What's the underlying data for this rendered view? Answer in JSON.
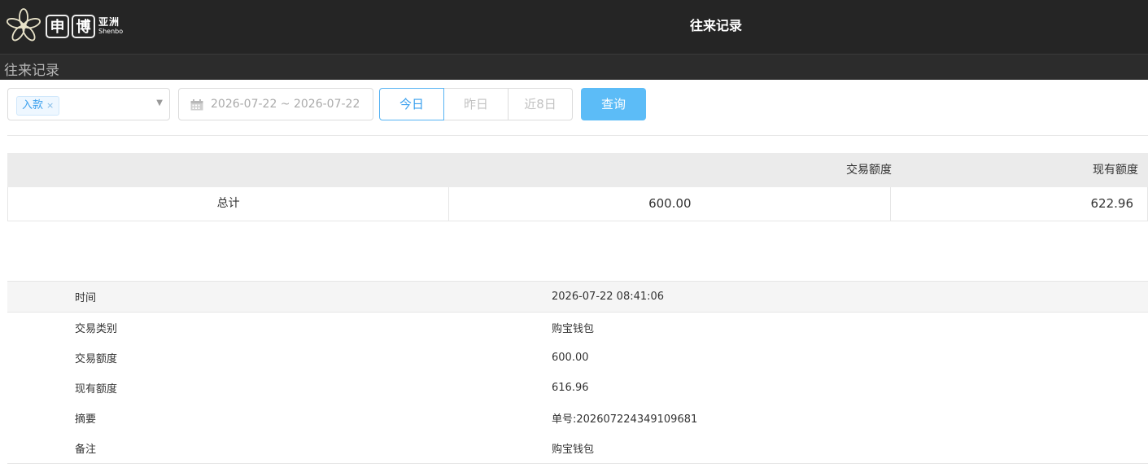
{
  "header": {
    "logo_char1": "申",
    "logo_char2": "博",
    "logo_cn": "亚洲",
    "logo_en": "Shenbo",
    "title": "往来记录"
  },
  "subheader": {
    "title": "往来记录"
  },
  "filters": {
    "type_tag": "入款",
    "type_tag_close": "×",
    "date_range": "2026-07-22 ~ 2026-07-22",
    "quick_today": "今日",
    "quick_yesterday": "昨日",
    "quick_8days": "近8日",
    "query_button": "查询"
  },
  "summary": {
    "headers": [
      "",
      "交易额度",
      "现有额度"
    ],
    "row": {
      "label": "总计",
      "amount": "600.00",
      "balance": "622.96"
    }
  },
  "detail": [
    {
      "label": "时间",
      "value": "2026-07-22 08:41:06"
    },
    {
      "label": "交易类别",
      "value": "购宝钱包"
    },
    {
      "label": "交易额度",
      "value": "600.00"
    },
    {
      "label": "现有额度",
      "value": "616.96"
    },
    {
      "label": "摘要",
      "value": "单号:202607224349109681"
    },
    {
      "label": "备注",
      "value": "购宝钱包"
    }
  ],
  "colors": {
    "topbar": "#252525",
    "accent": "#3aa0ee",
    "query_button": "#5cbcf7"
  }
}
